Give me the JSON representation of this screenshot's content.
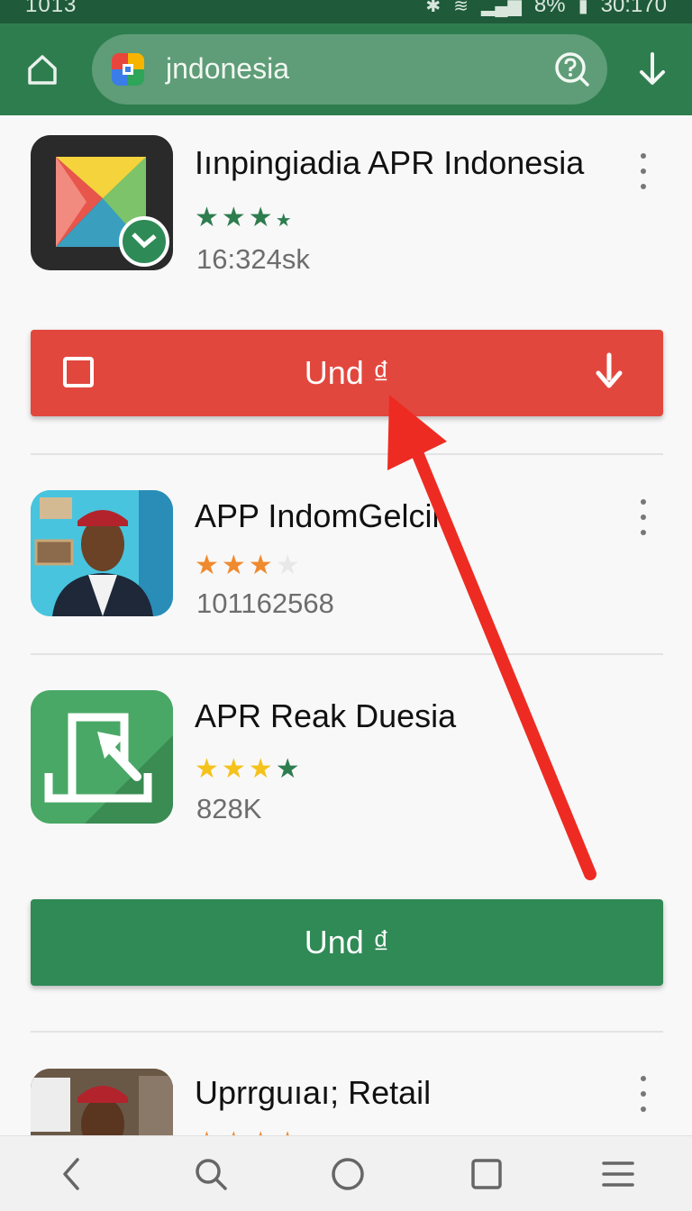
{
  "status_bar": {
    "time_left": "1013",
    "battery": "8%",
    "clock": "30:170"
  },
  "toolbar": {
    "search_query": "jndonesia"
  },
  "apps": [
    {
      "title": "Iınpingiadia APR Indonesia",
      "rating": 3.5,
      "stars_color": "#2e7d4f",
      "meta": "16:324sk"
    },
    {
      "title": "APP IndomGelcil",
      "rating": 3.5,
      "stars_color": "#f08a2e",
      "meta": "101162568"
    },
    {
      "title": "APR Reak Duesia",
      "rating": 4,
      "stars_color": "#f4c21a",
      "meta": "828K"
    },
    {
      "title": "Uprrguıaı; Retail",
      "rating": 3.5,
      "stars_color": "#f08a2e",
      "meta": ""
    }
  ],
  "buttons": {
    "red_label": "Und ₫",
    "green_label": "Und ₫"
  },
  "colors": {
    "brand_green": "#2e7d4f",
    "accent_red": "#e2473e",
    "button_green": "#2f8a55"
  },
  "icons": {
    "home": "home-icon",
    "help": "help-icon",
    "download": "download-icon",
    "nav": [
      "back-icon",
      "search-icon",
      "home-circle-icon",
      "recents-icon",
      "menu-icon"
    ]
  }
}
